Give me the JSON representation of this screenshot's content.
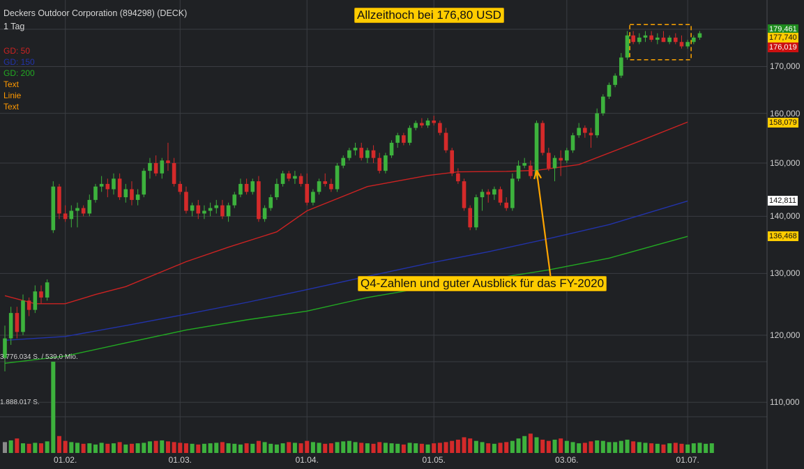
{
  "header": {
    "title": "Deckers Outdoor Corporation (894298) (DECK)",
    "interval": "1 Tag"
  },
  "legend": [
    {
      "label": "GD: 50",
      "color": "#cc2222"
    },
    {
      "label": "GD: 150",
      "color": "#2233aa"
    },
    {
      "label": "GD: 200",
      "color": "#22aa22"
    },
    {
      "label": "Text",
      "color": "#ff9900"
    },
    {
      "label": "Linie",
      "color": "#ff9900"
    },
    {
      "label": "Text",
      "color": "#ff9900"
    }
  ],
  "annotations": {
    "ath": "Allzeithoch bei 176,80 USD",
    "q4": "Q4-Zahlen und guter Ausblick für das FY-2020"
  },
  "volume_labels": {
    "max": "3.776.034 S. / 539,0 Mio.",
    "half": "1.888.017 S."
  },
  "price_tags": [
    {
      "text": "179,461",
      "value": 179.461,
      "bg": "#1e8a1e",
      "fg": "#ffffff"
    },
    {
      "text": "177,740",
      "value": 177.74,
      "bg": "#ffcc00",
      "fg": "#111111"
    },
    {
      "text": "176,019",
      "value": 176.019,
      "bg": "#cc1111",
      "fg": "#ffffff"
    },
    {
      "text": "158,079",
      "value": 158.079,
      "bg": "#ffcc00",
      "fg": "#111111"
    },
    {
      "text": "142,811",
      "value": 142.811,
      "bg": "#ffffff",
      "fg": "#111111"
    },
    {
      "text": "136,468",
      "value": 136.468,
      "bg": "#ffcc00",
      "fg": "#111111"
    }
  ],
  "colors": {
    "up": "#3db23d",
    "down": "#d42a2a",
    "ma50": "#cc2222",
    "ma150": "#2233aa",
    "ma200": "#22aa22",
    "annotation": "#ffa500",
    "grid": "#3a3d42"
  },
  "chart_data": {
    "type": "candlestick",
    "y_scale": "log",
    "ylim": [
      103,
      182
    ],
    "yticks": [
      110,
      120,
      130,
      140,
      150,
      160,
      170
    ],
    "ytick_labels": [
      "110,000",
      "120,000",
      "130,000",
      "140,000",
      "150,000",
      "160,000",
      "170,000"
    ],
    "xticks": [
      {
        "label": "01.02.",
        "index": 10
      },
      {
        "label": "01.03.",
        "index": 29
      },
      {
        "label": "01.04.",
        "index": 50
      },
      {
        "label": "01.05.",
        "index": 71
      },
      {
        "label": "03.06.",
        "index": 93
      },
      {
        "label": "01.07.",
        "index": 113
      }
    ],
    "ohlc": [
      [
        116.5,
        121.5,
        114.5,
        119.5
      ],
      [
        119.5,
        124.5,
        118.5,
        123.5
      ],
      [
        123.5,
        124.5,
        119.5,
        120.5
      ],
      [
        120.5,
        126.5,
        120,
        125.5
      ],
      [
        125.5,
        126,
        123,
        124
      ],
      [
        124,
        128,
        123.5,
        127
      ],
      [
        127,
        128,
        125,
        126
      ],
      [
        126,
        129,
        125.5,
        128.5
      ],
      [
        137.5,
        146.5,
        137,
        145.5
      ],
      [
        145.5,
        146,
        139.5,
        140.5
      ],
      [
        140.5,
        142,
        139,
        139.5
      ],
      [
        139.5,
        142,
        138,
        141
      ],
      [
        141,
        142.5,
        138,
        141.5
      ],
      [
        141.5,
        142,
        140,
        140.5
      ],
      [
        140.5,
        144,
        140,
        143
      ],
      [
        143,
        146,
        142.5,
        145.5
      ],
      [
        145.5,
        147.5,
        144.5,
        146
      ],
      [
        146,
        147,
        143.5,
        145
      ],
      [
        145,
        148,
        144,
        147
      ],
      [
        147,
        148,
        143,
        143.5
      ],
      [
        143.5,
        146,
        142.5,
        145
      ],
      [
        145,
        146.5,
        142,
        143
      ],
      [
        143,
        145,
        142,
        144
      ],
      [
        144,
        149,
        143.5,
        148.5
      ],
      [
        148.5,
        151,
        147,
        150
      ],
      [
        150,
        151.5,
        147.5,
        148
      ],
      [
        148,
        151,
        147,
        150.5
      ],
      [
        150.5,
        154,
        148.5,
        150
      ],
      [
        150,
        151,
        145.5,
        146
      ],
      [
        146,
        146.5,
        144,
        144.5
      ],
      [
        144.5,
        145.5,
        140.5,
        141
      ],
      [
        141,
        142.5,
        140,
        142
      ],
      [
        142,
        143,
        139.5,
        140.5
      ],
      [
        140.5,
        142,
        139.5,
        141
      ],
      [
        141,
        142.5,
        140,
        141.5
      ],
      [
        141.5,
        143,
        140.5,
        142
      ],
      [
        142,
        143,
        139.5,
        140
      ],
      [
        140,
        142.5,
        139,
        142
      ],
      [
        142,
        144.5,
        141.5,
        144
      ],
      [
        144,
        147,
        143.5,
        146
      ],
      [
        146,
        147,
        144,
        144.5
      ],
      [
        144.5,
        147,
        144,
        146.5
      ],
      [
        146.5,
        147.5,
        139,
        139.5
      ],
      [
        139.5,
        142,
        139,
        141.5
      ],
      [
        141.5,
        144,
        141,
        143.5
      ],
      [
        143.5,
        147,
        143,
        146
      ],
      [
        146,
        148.5,
        145.5,
        148
      ],
      [
        148,
        148.5,
        146.5,
        147
      ],
      [
        147,
        148.5,
        146,
        147.5
      ],
      [
        147.5,
        148,
        145.5,
        146
      ],
      [
        146,
        148,
        142,
        142.5
      ],
      [
        142.5,
        145,
        142,
        144.5
      ],
      [
        144.5,
        147,
        144,
        146.5
      ],
      [
        146.5,
        148,
        145.5,
        146
      ],
      [
        146,
        147,
        144.5,
        145
      ],
      [
        145,
        150,
        144.5,
        149.5
      ],
      [
        149.5,
        151.5,
        149,
        151
      ],
      [
        151,
        153,
        150.5,
        152.5
      ],
      [
        152.5,
        154,
        151.5,
        153
      ],
      [
        153,
        154,
        150.5,
        151
      ],
      [
        151,
        153,
        150,
        152.5
      ],
      [
        152.5,
        153.5,
        150,
        151
      ],
      [
        151,
        152,
        148,
        148.5
      ],
      [
        148.5,
        152,
        148,
        151.5
      ],
      [
        151.5,
        154.5,
        151,
        154
      ],
      [
        154,
        156,
        153,
        155.5
      ],
      [
        155.5,
        156,
        153.5,
        154
      ],
      [
        154,
        157.5,
        153.5,
        157
      ],
      [
        157,
        158.5,
        156.5,
        158
      ],
      [
        158,
        159,
        157,
        157.5
      ],
      [
        157.5,
        159,
        157,
        158.5
      ],
      [
        158.5,
        159.5,
        157.5,
        158
      ],
      [
        158,
        158.5,
        155.5,
        156
      ],
      [
        156,
        157,
        152,
        152.5
      ],
      [
        152.5,
        153,
        147.5,
        148
      ],
      [
        148,
        149,
        146,
        146.5
      ],
      [
        146.5,
        147,
        141,
        141.5
      ],
      [
        141.5,
        142,
        137.5,
        138
      ],
      [
        138,
        144,
        137.5,
        143.5
      ],
      [
        143.5,
        145,
        141,
        144.5
      ],
      [
        144.5,
        145,
        142.5,
        144
      ],
      [
        144,
        145.5,
        143,
        145
      ],
      [
        145,
        145.5,
        142,
        142.5
      ],
      [
        142.5,
        143.5,
        141,
        141.5
      ],
      [
        141.5,
        148,
        141,
        147
      ],
      [
        147,
        150.5,
        146.5,
        149.5
      ],
      [
        149.5,
        151,
        149,
        150
      ],
      [
        149.5,
        150.5,
        147,
        147.5
      ],
      [
        147.5,
        158.5,
        147,
        158
      ],
      [
        158,
        158.5,
        151.5,
        152
      ],
      [
        152,
        153,
        148.5,
        149
      ],
      [
        149,
        151.5,
        146.5,
        151
      ],
      [
        151,
        152.5,
        147.5,
        150.5
      ],
      [
        150.5,
        153,
        150,
        152.5
      ],
      [
        152.5,
        156,
        152,
        155.5
      ],
      [
        155.5,
        158,
        155,
        157
      ],
      [
        157,
        157.5,
        155,
        156
      ],
      [
        156,
        157,
        153,
        155.5
      ],
      [
        155.5,
        161,
        155,
        160
      ],
      [
        160,
        164,
        159.5,
        163.5
      ],
      [
        163.5,
        166.5,
        163,
        166
      ],
      [
        166,
        168.5,
        165.5,
        168
      ],
      [
        168,
        173,
        167.5,
        172
      ],
      [
        172,
        178,
        171.5,
        177
      ],
      [
        177,
        178,
        175,
        175.5
      ],
      [
        175.5,
        177.5,
        175,
        176.5
      ],
      [
        176.5,
        178,
        175.5,
        177
      ],
      [
        177,
        178,
        175.5,
        176
      ],
      [
        176,
        177.5,
        175,
        176.5
      ],
      [
        176.5,
        178,
        175.5,
        175.5
      ],
      [
        175.5,
        177,
        175,
        176.5
      ],
      [
        176.5,
        177.5,
        175,
        175.5
      ],
      [
        175.5,
        177,
        174,
        174.5
      ],
      [
        174.5,
        176,
        174,
        175.5
      ],
      [
        175.5,
        177,
        175,
        176.5
      ],
      [
        176.5,
        178,
        176,
        177.5
      ]
    ],
    "volume_max": 3776034,
    "volume": [
      450000,
      520000,
      600000,
      400000,
      380000,
      420000,
      400000,
      480000,
      3776034,
      700000,
      500000,
      450000,
      420000,
      380000,
      400000,
      350000,
      420000,
      380000,
      400000,
      450000,
      350000,
      380000,
      400000,
      420000,
      480000,
      500000,
      520000,
      480000,
      450000,
      420000,
      400000,
      380000,
      350000,
      380000,
      400000,
      420000,
      450000,
      400000,
      380000,
      350000,
      400000,
      380000,
      500000,
      450000,
      380000,
      350000,
      400000,
      450000,
      420000,
      400000,
      500000,
      450000,
      420000,
      380000,
      400000,
      450000,
      480000,
      500000,
      450000,
      420000,
      400000,
      380000,
      450000,
      420000,
      400000,
      380000,
      350000,
      420000,
      400000,
      380000,
      350000,
      400000,
      420000,
      450000,
      500000,
      550000,
      650000,
      600000,
      500000,
      450000,
      400000,
      380000,
      420000,
      450000,
      500000,
      600000,
      700000,
      800000,
      650000,
      550000,
      500000,
      550000,
      600000,
      500000,
      450000,
      400000,
      420000,
      480000,
      520000,
      500000,
      450000,
      450000,
      500000,
      550000,
      480000,
      450000,
      420000,
      400000,
      380000,
      350000,
      400000,
      420000,
      380000,
      350000,
      400000,
      420000,
      380000,
      400000
    ],
    "ma50": [
      [
        0,
        126.3
      ],
      [
        5,
        125.0
      ],
      [
        10,
        125.0
      ],
      [
        15,
        126.5
      ],
      [
        20,
        127.8
      ],
      [
        30,
        132.0
      ],
      [
        37,
        134.5
      ],
      [
        45,
        137.2
      ],
      [
        50,
        141.0
      ],
      [
        60,
        145.5
      ],
      [
        70,
        147.6
      ],
      [
        75,
        148.3
      ],
      [
        83,
        148.4
      ],
      [
        88,
        148.6
      ],
      [
        95,
        149.7
      ],
      [
        105,
        154.3
      ],
      [
        113,
        158.2
      ]
    ],
    "ma150": [
      [
        0,
        119.2
      ],
      [
        10,
        119.8
      ],
      [
        20,
        121.5
      ],
      [
        30,
        123.3
      ],
      [
        40,
        125.2
      ],
      [
        50,
        127.3
      ],
      [
        60,
        129.5
      ],
      [
        70,
        131.7
      ],
      [
        80,
        133.7
      ],
      [
        90,
        136.0
      ],
      [
        100,
        138.5
      ],
      [
        113,
        142.8
      ]
    ],
    "ma200": [
      [
        0,
        115.7
      ],
      [
        10,
        116.8
      ],
      [
        20,
        118.8
      ],
      [
        30,
        120.8
      ],
      [
        40,
        122.4
      ],
      [
        50,
        123.8
      ],
      [
        60,
        126.0
      ],
      [
        70,
        127.7
      ],
      [
        80,
        129.0
      ],
      [
        90,
        130.6
      ],
      [
        100,
        132.6
      ],
      [
        113,
        136.4
      ]
    ],
    "ath_box": {
      "from_index": 104,
      "to_index": 113,
      "low": 171.5,
      "high": 179.5
    },
    "q4_arrow": {
      "index": 88,
      "from_value": 129.5,
      "to_value": 148.6
    }
  }
}
